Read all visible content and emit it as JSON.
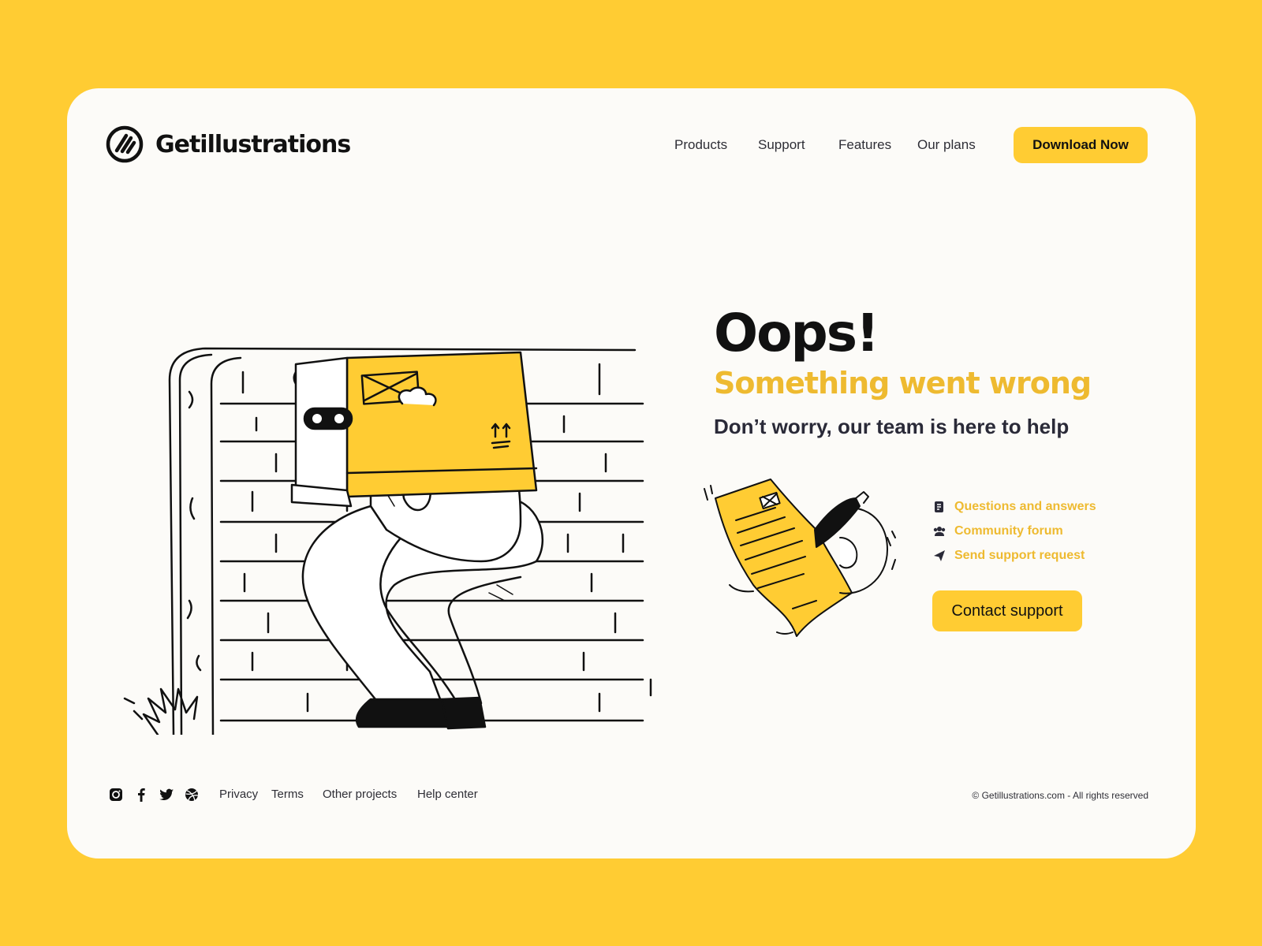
{
  "brand": {
    "name": "Getillustrations"
  },
  "nav": {
    "items": [
      {
        "label": "Products"
      },
      {
        "label": "Support"
      },
      {
        "label": "Features"
      },
      {
        "label": "Our plans"
      }
    ],
    "cta_label": "Download Now"
  },
  "main": {
    "title": "Oops!",
    "subtitle": "Something went wrong",
    "tagline": "Don’t worry, our team is here to help",
    "help_links": [
      {
        "label": "Questions and answers",
        "icon": "document-icon"
      },
      {
        "label": "Community forum",
        "icon": "people-icon"
      },
      {
        "label": "Send support request",
        "icon": "paper-plane-icon"
      }
    ],
    "contact_label": "Contact support"
  },
  "footer": {
    "social": [
      "instagram-icon",
      "facebook-icon",
      "twitter-icon",
      "dribbble-icon"
    ],
    "links": [
      {
        "label": "Privacy"
      },
      {
        "label": "Terms"
      },
      {
        "label": "Other projects"
      },
      {
        "label": "Help center"
      }
    ],
    "copyright": "© Getillustrations.com - All rights reserved"
  },
  "colors": {
    "background": "#FFCC33",
    "card": "#FCFBF8",
    "accent": "#EEBA30",
    "text": "#16161E"
  }
}
